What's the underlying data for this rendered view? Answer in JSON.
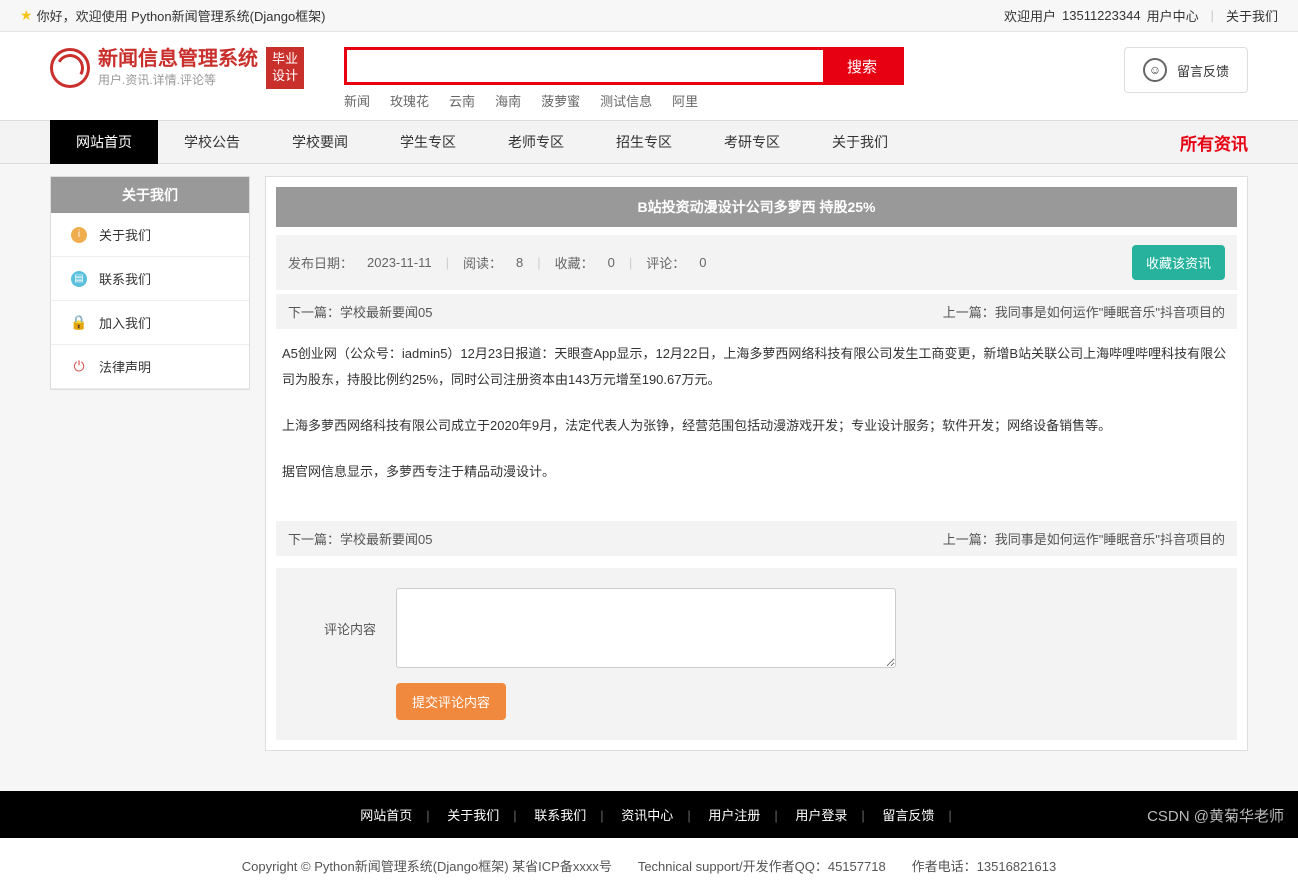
{
  "topbar": {
    "welcome": "你好，欢迎使用 Python新闻管理系统(Django框架)",
    "welcome_user_label": "欢迎用户",
    "phone": "13511223344",
    "user_center": "用户中心",
    "about": "关于我们"
  },
  "logo": {
    "title": "新闻信息管理系统",
    "subtitle": "用户.资讯.详情.评论等",
    "badge_line1": "毕业",
    "badge_line2": "设计"
  },
  "search": {
    "button": "搜索",
    "hotwords": [
      "新闻",
      "玫瑰花",
      "云南",
      "海南",
      "菠萝蜜",
      "测试信息",
      "阿里"
    ]
  },
  "feedback": {
    "label": "留言反馈"
  },
  "nav": {
    "items": [
      "网站首页",
      "学校公告",
      "学校要闻",
      "学生专区",
      "老师专区",
      "招生专区",
      "考研专区",
      "关于我们"
    ],
    "right": "所有资讯"
  },
  "sidebar": {
    "title": "关于我们",
    "items": [
      {
        "label": "关于我们",
        "icon": "info"
      },
      {
        "label": "联系我们",
        "icon": "doc"
      },
      {
        "label": "加入我们",
        "icon": "lock"
      },
      {
        "label": "法律声明",
        "icon": "power"
      }
    ]
  },
  "article": {
    "title": "B站投资动漫设计公司多萝西 持股25%",
    "date_label": "发布日期：",
    "date": "2023-11-11",
    "read_label": "阅读：",
    "read": "8",
    "fav_label": "收藏：",
    "fav": "0",
    "cmt_label": "评论：",
    "cmt": "0",
    "fav_button": "收藏该资讯",
    "next_label": "下一篇：",
    "next_title": "学校最新要闻05",
    "prev_label": "上一篇：",
    "prev_title": "我同事是如何运作\"睡眠音乐\"抖音项目的",
    "body_p1": "A5创业网（公众号：iadmin5）12月23日报道：天眼查App显示，12月22日，上海多萝西网络科技有限公司发生工商变更，新增B站关联公司上海哔哩哔哩科技有限公司为股东，持股比例约25%，同时公司注册资本由143万元增至190.67万元。",
    "body_p2": "上海多萝西网络科技有限公司成立于2020年9月，法定代表人为张铮，经营范围包括动漫游戏开发；专业设计服务；软件开发；网络设备销售等。",
    "body_p3": "据官网信息显示，多萝西专注于精品动漫设计。"
  },
  "comment": {
    "label": "评论内容",
    "submit": "提交评论内容"
  },
  "footer": {
    "links": [
      "网站首页",
      "关于我们",
      "联系我们",
      "资讯中心",
      "用户注册",
      "用户登录",
      "留言反馈"
    ],
    "copyright": "Copyright © Python新闻管理系统(Django框架) 某省ICP备xxxx号　　Technical support/开发作者QQ：45157718　　作者电话：13516821613"
  },
  "watermark": "CSDN @黄菊华老师"
}
